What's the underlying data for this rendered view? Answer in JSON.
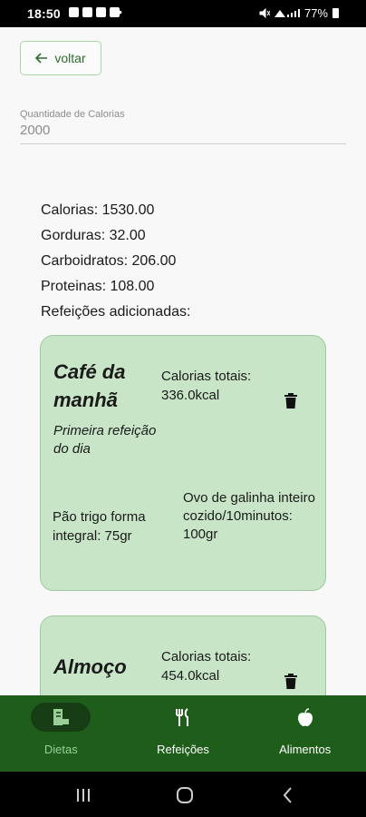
{
  "status_bar": {
    "time": "18:50",
    "extra": "•",
    "battery": "77%"
  },
  "back_button": {
    "label": "voltar"
  },
  "calories_field": {
    "label": "Quantidade de Calorias",
    "value": "2000"
  },
  "summary": {
    "calories": "Calorias: 1530.00",
    "fats": "Gorduras: 32.00",
    "carbs": "Carboidratos: 206.00",
    "proteins": "Proteinas: 108.00",
    "added_meals": "Refeições adicionadas:"
  },
  "meals": [
    {
      "title": "Café da manhã",
      "description": "Primeira refeição do dia",
      "totals_label": "Calorias totais:",
      "totals_value": "336.0kcal",
      "foods": [
        "Pão trigo forma integral: 75gr",
        "Ovo de galinha inteiro cozido/10minutos: 100gr"
      ]
    },
    {
      "title": "Almoço",
      "totals_label": "Calorias totais:",
      "totals_value": "454.0kcal"
    }
  ],
  "bottom_nav": {
    "items": [
      {
        "label": "Dietas",
        "icon": "diet-icon",
        "active": true
      },
      {
        "label": "Refeições",
        "icon": "fork-knife-icon",
        "active": false
      },
      {
        "label": "Alimentos",
        "icon": "apple-icon",
        "active": false
      }
    ]
  },
  "colors": {
    "accent": "#1f5d1b",
    "card": "#c8e6c7",
    "active_label": "#9acf97"
  }
}
